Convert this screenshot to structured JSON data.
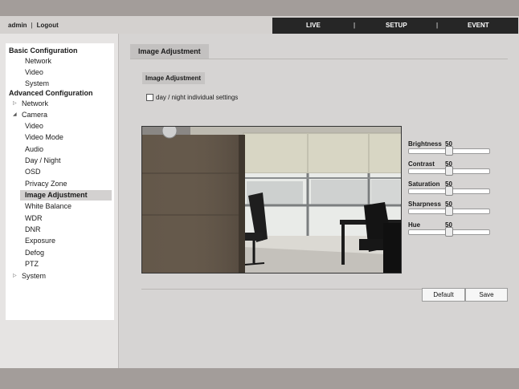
{
  "header": {
    "user_label": "admin",
    "separator": "|",
    "logout_label": "Logout",
    "nav": [
      {
        "label": "LIVE"
      },
      {
        "label": "SETUP"
      },
      {
        "label": "EVENT"
      }
    ],
    "nav_divider": "|"
  },
  "sidebar": {
    "basic_heading": "Basic Configuration",
    "basic_items": [
      {
        "label": "Network"
      },
      {
        "label": "Video"
      },
      {
        "label": "System"
      }
    ],
    "advanced_heading": "Advanced Configuration",
    "network_label": "Network",
    "camera_label": "Camera",
    "camera_items": [
      {
        "label": "Video"
      },
      {
        "label": "Video Mode"
      },
      {
        "label": "Audio"
      },
      {
        "label": "Day / Night"
      },
      {
        "label": "OSD"
      },
      {
        "label": "Privacy Zone"
      },
      {
        "label": "Image Adjustment"
      },
      {
        "label": "White Balance"
      },
      {
        "label": "WDR"
      },
      {
        "label": "DNR"
      },
      {
        "label": "Exposure"
      },
      {
        "label": "Defog"
      },
      {
        "label": "PTZ"
      }
    ],
    "system_label": "System",
    "icons": {
      "expand": "triangle-right-icon",
      "collapse": "triangle-down-icon"
    }
  },
  "main": {
    "tab_label": "Image Adjustment",
    "section_title": "Image Adjustment",
    "checkbox_label": "day / night individual settings",
    "checkbox_checked": false,
    "sliders": [
      {
        "label": "Brightness",
        "value": "50",
        "level": 0.5
      },
      {
        "label": "Contrast",
        "value": "50",
        "level": 0.5
      },
      {
        "label": "Saturation",
        "value": "50",
        "level": 0.5
      },
      {
        "label": "Sharpness",
        "value": "50",
        "level": 0.5
      },
      {
        "label": "Hue",
        "value": "50",
        "level": 0.5
      }
    ],
    "default_button": "Default",
    "save_button": "Save"
  },
  "colors": {
    "bar": "#a39d9a",
    "nav_bg": "#262626",
    "active_item": "#d3d1d0",
    "sidebar_bg": "#ffffff"
  }
}
